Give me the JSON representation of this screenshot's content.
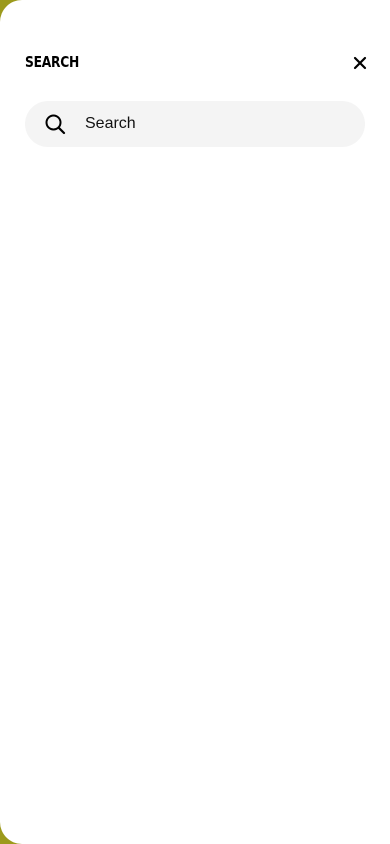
{
  "header": {
    "title": "SEARCH",
    "close_icon": "close-icon"
  },
  "search": {
    "placeholder": "Search",
    "value": "",
    "icon": "search-icon"
  },
  "colors": {
    "backdrop": "#9c9a1c",
    "panel": "#ffffff",
    "search_field_bg": "#f4f4f4",
    "text": "#000000"
  }
}
